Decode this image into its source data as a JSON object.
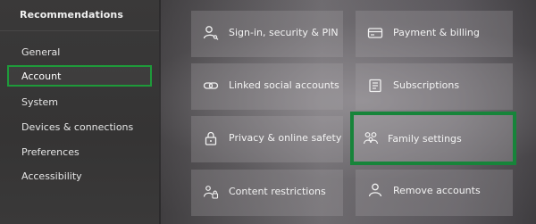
{
  "sidebar": {
    "header": "Recommendations",
    "items": [
      {
        "label": "General"
      },
      {
        "label": "Account"
      },
      {
        "label": "System"
      },
      {
        "label": "Devices & connections"
      },
      {
        "label": "Preferences"
      },
      {
        "label": "Accessibility"
      }
    ],
    "selected_item": "Account"
  },
  "tiles": [
    {
      "label": "Sign-in, security & PIN",
      "icon": "person-key-icon"
    },
    {
      "label": "Payment & billing",
      "icon": "credit-card-icon"
    },
    {
      "label": "Linked social accounts",
      "icon": "link-icon"
    },
    {
      "label": "Subscriptions",
      "icon": "subscriptions-icon"
    },
    {
      "label": "Privacy & online safety",
      "icon": "lock-icon"
    },
    {
      "label": "Family settings",
      "icon": "family-icon"
    },
    {
      "label": "Content restrictions",
      "icon": "content-restrictions-icon"
    },
    {
      "label": "Remove accounts",
      "icon": "person-icon"
    }
  ],
  "highlighted_tile": "Family settings",
  "colors": {
    "selection_border": "#1e9a3a",
    "highlight_border": "#17843a"
  }
}
